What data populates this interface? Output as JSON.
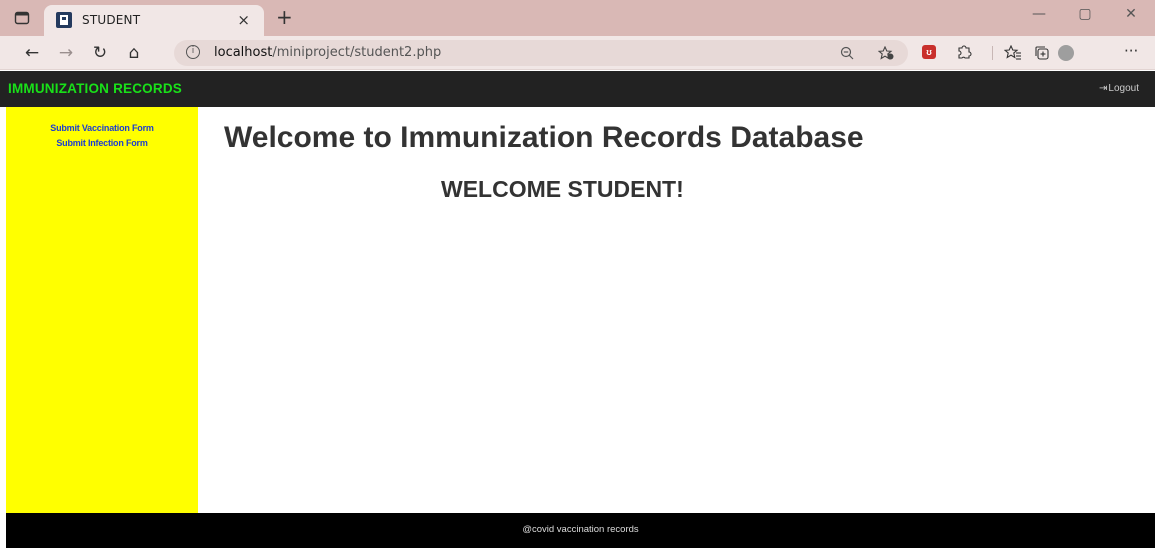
{
  "browser": {
    "tab_title": "STUDENT",
    "tab_close_glyph": "×",
    "new_tab_glyph": "+",
    "url_host": "localhost",
    "url_path": "/miniproject/student2.php",
    "window_controls": {
      "minimize": "—",
      "maximize": "▢",
      "close": "✕"
    },
    "nav": {
      "back": "←",
      "forward": "→",
      "refresh": "↻",
      "home": "⌂"
    },
    "icons": {
      "tab_actions": "tab-actions-icon",
      "favicon": "page-favicon-icon",
      "info": "site-info-icon",
      "zoom": "zoom-out-icon",
      "favorite_add": "add-favorite-icon",
      "extension": "extension-icon",
      "puzzle": "extensions-icon",
      "favorites": "favorites-icon",
      "collections": "collections-icon",
      "profile": "profile-icon",
      "more": "more-menu-icon"
    },
    "more_glyph": "···"
  },
  "navbar": {
    "brand": "IMMUNIZATION RECORDS",
    "logout_label": "Logout",
    "logout_icon": "logout-icon"
  },
  "sidebar": {
    "items": [
      {
        "label": "Submit Vaccination Form"
      },
      {
        "label": "Submit Infection Form"
      }
    ]
  },
  "main": {
    "title": "Welcome to Immunization Records Database",
    "subtitle": "WELCOME STUDENT!"
  },
  "footer": {
    "text": "@covid vaccination records"
  },
  "colors": {
    "tabstrip": "#d9b8b5",
    "toolbar": "#f1e7e6",
    "navbar": "#222222",
    "brand": "#19e019",
    "sidebar": "#ffff00",
    "sidebar_link": "#1e3fcf",
    "heading": "#333333",
    "footer": "#000000"
  }
}
